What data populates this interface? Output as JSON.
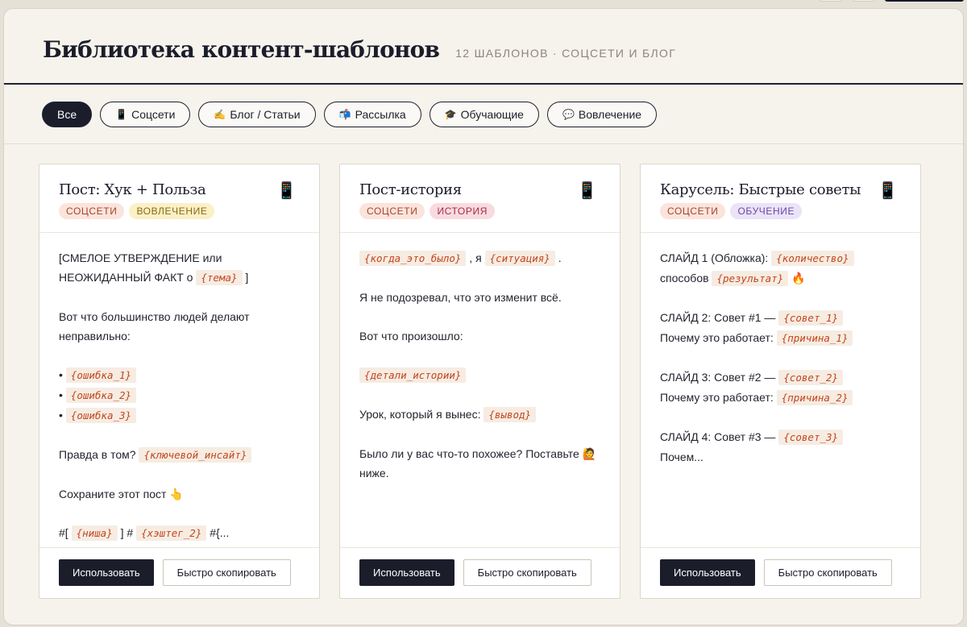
{
  "header": {
    "title": "Библиотека контент-шаблонов",
    "subtitle": "12 шаблонов · соцсети и блог"
  },
  "filters": [
    {
      "label": "Все",
      "icon": "",
      "active": true
    },
    {
      "label": "Соцсети",
      "icon": "📱",
      "active": false
    },
    {
      "label": "Блог / Статьи",
      "icon": "✍️",
      "active": false
    },
    {
      "label": "Рассылка",
      "icon": "📬",
      "active": false
    },
    {
      "label": "Обучающие",
      "icon": "🎓",
      "active": false
    },
    {
      "label": "Вовлечение",
      "icon": "💬",
      "active": false
    }
  ],
  "cards": [
    {
      "title": "Пост: Хук + Польза",
      "icon": "📱",
      "tags": [
        {
          "label": "Соцсети",
          "kind": "social"
        },
        {
          "label": "Вовлечение",
          "kind": "engage"
        }
      ],
      "lines": [
        [
          {
            "t": "[СМЕЛОЕ УТВЕРЖДЕНИЕ или"
          }
        ],
        [
          {
            "t": "НЕОЖИДАННЫЙ ФАКТ о "
          },
          {
            "ph": "{тема}"
          },
          {
            "t": " ]"
          }
        ],
        [],
        [
          {
            "t": "Вот что большинство людей делают"
          }
        ],
        [
          {
            "t": "неправильно:"
          }
        ],
        [],
        [
          {
            "t": "• "
          },
          {
            "ph": "{ошибка_1}"
          }
        ],
        [
          {
            "t": "• "
          },
          {
            "ph": "{ошибка_2}"
          }
        ],
        [
          {
            "t": "• "
          },
          {
            "ph": "{ошибка_3}"
          }
        ],
        [],
        [
          {
            "t": "Правда в том? "
          },
          {
            "ph": "{ключевой_инсайт}"
          }
        ],
        [],
        [
          {
            "t": "Сохраните этот пост 👆"
          }
        ],
        [],
        [
          {
            "t": "#[ "
          },
          {
            "ph": "{ниша}"
          },
          {
            "t": " ] # "
          },
          {
            "ph": "{хэштег_2}"
          },
          {
            "t": " #{..."
          }
        ]
      ],
      "use_label": "Использовать",
      "copy_label": "Быстро скопировать"
    },
    {
      "title": "Пост-история",
      "icon": "📱",
      "tags": [
        {
          "label": "Соцсети",
          "kind": "social"
        },
        {
          "label": "История",
          "kind": "story"
        }
      ],
      "lines": [
        [
          {
            "ph": "{когда_это_было}"
          },
          {
            "t": " , я "
          },
          {
            "ph": "{ситуация}"
          },
          {
            "t": " ."
          }
        ],
        [],
        [
          {
            "t": "Я не подозревал, что это изменит всё."
          }
        ],
        [],
        [
          {
            "t": "Вот что произошло:"
          }
        ],
        [],
        [
          {
            "ph": "{детали_истории}"
          }
        ],
        [],
        [
          {
            "t": "Урок, который я вынес: "
          },
          {
            "ph": "{вывод}"
          }
        ],
        [],
        [
          {
            "t": "Было ли у вас что-то похожее? Поставьте 🙋"
          }
        ],
        [
          {
            "t": "ниже."
          }
        ]
      ],
      "use_label": "Использовать",
      "copy_label": "Быстро скопировать"
    },
    {
      "title": "Карусель: Быстрые советы",
      "icon": "📱",
      "tags": [
        {
          "label": "Соцсети",
          "kind": "social"
        },
        {
          "label": "Обучение",
          "kind": "edu"
        }
      ],
      "lines": [
        [
          {
            "t": "СЛАЙД 1 (Обложка): "
          },
          {
            "ph": "{количество}"
          }
        ],
        [
          {
            "t": "способов "
          },
          {
            "ph": "{результат}"
          },
          {
            "t": " 🔥"
          }
        ],
        [],
        [
          {
            "t": "СЛАЙД 2: Совет #1 — "
          },
          {
            "ph": "{совет_1}"
          }
        ],
        [
          {
            "t": "Почему это работает: "
          },
          {
            "ph": "{причина_1}"
          }
        ],
        [],
        [
          {
            "t": "СЛАЙД 3: Совет #2 — "
          },
          {
            "ph": "{совет_2}"
          }
        ],
        [
          {
            "t": "Почему это работает: "
          },
          {
            "ph": "{причина_2}"
          }
        ],
        [],
        [
          {
            "t": "СЛАЙД 4: Совет #3 — "
          },
          {
            "ph": "{совет_3}"
          }
        ],
        [
          {
            "t": "Почем..."
          }
        ]
      ],
      "use_label": "Использовать",
      "copy_label": "Быстро скопировать"
    }
  ]
}
